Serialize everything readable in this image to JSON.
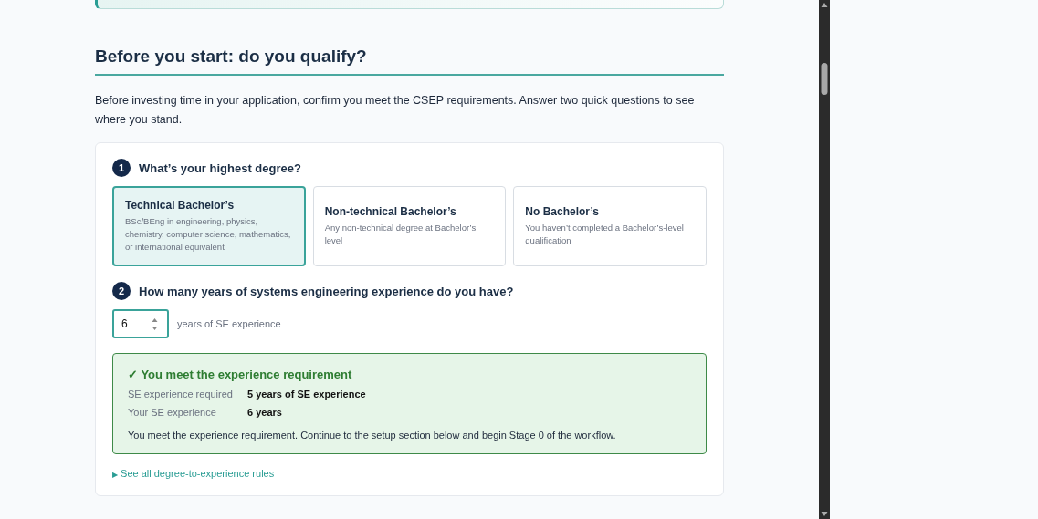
{
  "section": {
    "title": "Before you start: do you qualify?",
    "intro": "Before investing time in your application, confirm you meet the CSEP requirements. Answer two quick questions to see where you stand."
  },
  "questions": [
    {
      "number": "1",
      "text": "What’s your highest degree?"
    },
    {
      "number": "2",
      "text": "How many years of systems engineering experience do you have?"
    }
  ],
  "degree_options": [
    {
      "title": "Technical Bachelor’s",
      "description": "BSc/BEng in engineering, physics, chemistry, computer science, mathematics, or international equivalent",
      "selected": true
    },
    {
      "title": "Non-technical Bachelor’s",
      "description": "Any non-technical degree at Bachelor’s level",
      "selected": false
    },
    {
      "title": "No Bachelor’s",
      "description": "You haven’t completed a Bachelor’s-level qualification",
      "selected": false
    }
  ],
  "experience": {
    "value": "6",
    "unit": "years of SE experience"
  },
  "result": {
    "met": true,
    "title": "✓ You meet the experience requirement",
    "rows": [
      {
        "label": "SE experience required",
        "value": "5 years of SE experience"
      },
      {
        "label": "Your SE experience",
        "value": "6 years"
      }
    ],
    "message": "You meet the experience requirement. Continue to the setup section below and begin Stage 0 of the workflow."
  },
  "rules_link": {
    "marker": "▶",
    "text": "See all degree-to-experience rules",
    "expanded": false
  }
}
